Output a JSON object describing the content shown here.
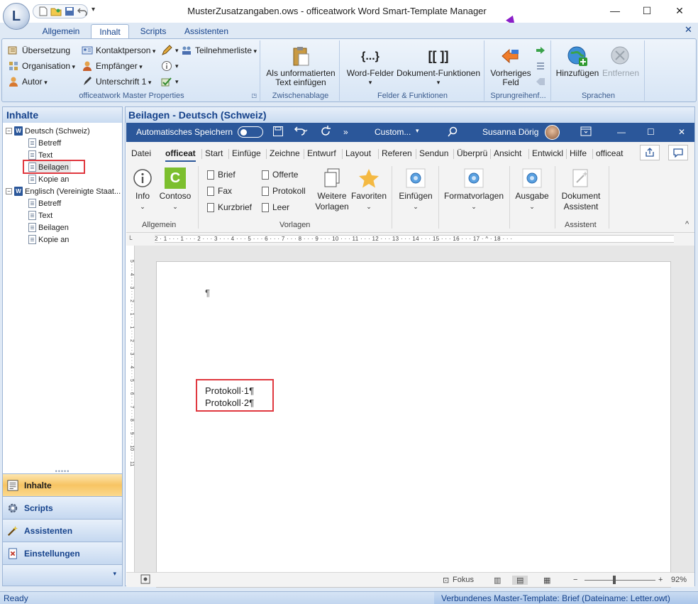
{
  "window": {
    "title": "MusterZusatzangaben.ows - officeatwork Word Smart-Template Manager",
    "minimize": "—",
    "maximize": "☐",
    "close": "✕"
  },
  "ribbon_tabs": [
    "Allgemein",
    "Inhalt",
    "Scripts",
    "Assistenten"
  ],
  "ribbon_close": "✕",
  "ribbon": {
    "master_props": {
      "uebersetzung": "Übersetzung",
      "organisation": "Organisation",
      "autor": "Autor",
      "kontaktperson": "Kontaktperson",
      "empfaenger": "Empfänger",
      "unterschrift": "Unterschrift 1",
      "teilnehmerliste": "Teilnehmerliste",
      "group_label": "officeatwork Master Properties"
    },
    "zwischenablage": {
      "als_unformatiert": "Als unformatierten Text einfügen",
      "group_label": "Zwischenablage"
    },
    "felder": {
      "word_felder": "Word-Felder",
      "word_felder_icon": "{...}",
      "dokument_funktionen": "Dokument-Funktionen",
      "dokument_funktionen_icon": "[[ ]]",
      "group_label": "Felder & Funktionen"
    },
    "sprung": {
      "vorheriges_feld": "Vorheriges Feld",
      "group_label": "Sprungreihenf..."
    },
    "sprachen": {
      "hinzufuegen": "Hinzufügen",
      "entfernen": "Entfernen",
      "group_label": "Sprachen"
    }
  },
  "left_panel": {
    "title": "Inhalte",
    "tree": {
      "lang1": "Deutsch (Schweiz)",
      "lang1_items": [
        "Betreff",
        "Text",
        "Beilagen",
        "Kopie an"
      ],
      "lang2": "Englisch (Vereinigte Staat...",
      "lang2_items": [
        "Betreff",
        "Text",
        "Beilagen",
        "Kopie an"
      ]
    },
    "splitter": "•••••",
    "nav": [
      "Inhalte",
      "Scripts",
      "Assistenten",
      "Einstellungen"
    ]
  },
  "right_panel": {
    "title": "Beilagen - Deutsch (Schweiz)"
  },
  "word": {
    "autosave": "Automatisches Speichern",
    "more": "»",
    "custom": "Custom...",
    "user": "Susanna Dörig",
    "tabs": [
      "Datei",
      "officeat",
      "Start",
      "Einfüge",
      "Zeichne",
      "Entwurf",
      "Layout",
      "Referen",
      "Sendun",
      "Überprü",
      "Ansicht",
      "Entwickl",
      "Hilfe",
      "officeat"
    ],
    "ribbon": {
      "info": "Info",
      "contoso": "Contoso",
      "contoso_logo": "C",
      "allgemein_label": "Allgemein",
      "brief": "Brief",
      "fax": "Fax",
      "kurzbrief": "Kurzbrief",
      "offerte": "Offerte",
      "protokoll": "Protokoll",
      "leer": "Leer",
      "weitere_vorlagen": "Weitere Vorlagen",
      "favoriten": "Favoriten",
      "vorlagen_label": "Vorlagen",
      "einfuegen": "Einfügen",
      "formatvorlagen": "Formatvorlagen",
      "ausgabe": "Ausgabe",
      "dokument_assistent": "Dokument Assistent",
      "assistent_label": "Assistent",
      "collapse": "^"
    },
    "ruler": "2 · 1 · · · 1 · · · 2 · · · 3 · · · 4 · · · 5 · · · 6 · · · 7 · · · 8 · · · 9 · · · 10 · · · 11 · · · 12 · · · 13 · · · 14 · · · 15 · · · 16 · · · 17 · ^ · 18 · · ·",
    "vruler": "5 · · · 4 · · · 3 · · · 2 · · · 1 · · · 1 · · · 2 · · · 3 · · · 4 · · · 5 · · · 6 · · · 7 · · · 8 · · · 9 · · · 10 · · · 11",
    "doc": {
      "para_mark": "¶",
      "line1": "Protokoll·1¶",
      "line2": "Protokoll·2¶"
    },
    "status": {
      "fokus": "Fokus",
      "zoom_minus": "−",
      "zoom_plus": "+",
      "zoom": "92%"
    }
  },
  "statusbar": {
    "left": "Ready",
    "right": "Verbundenes Master-Template: Brief (Dateiname: Letter.owt)"
  },
  "colors": {
    "accent": "#2b579a",
    "highlight": "#e0383f",
    "nav_active": "#f7c463"
  }
}
